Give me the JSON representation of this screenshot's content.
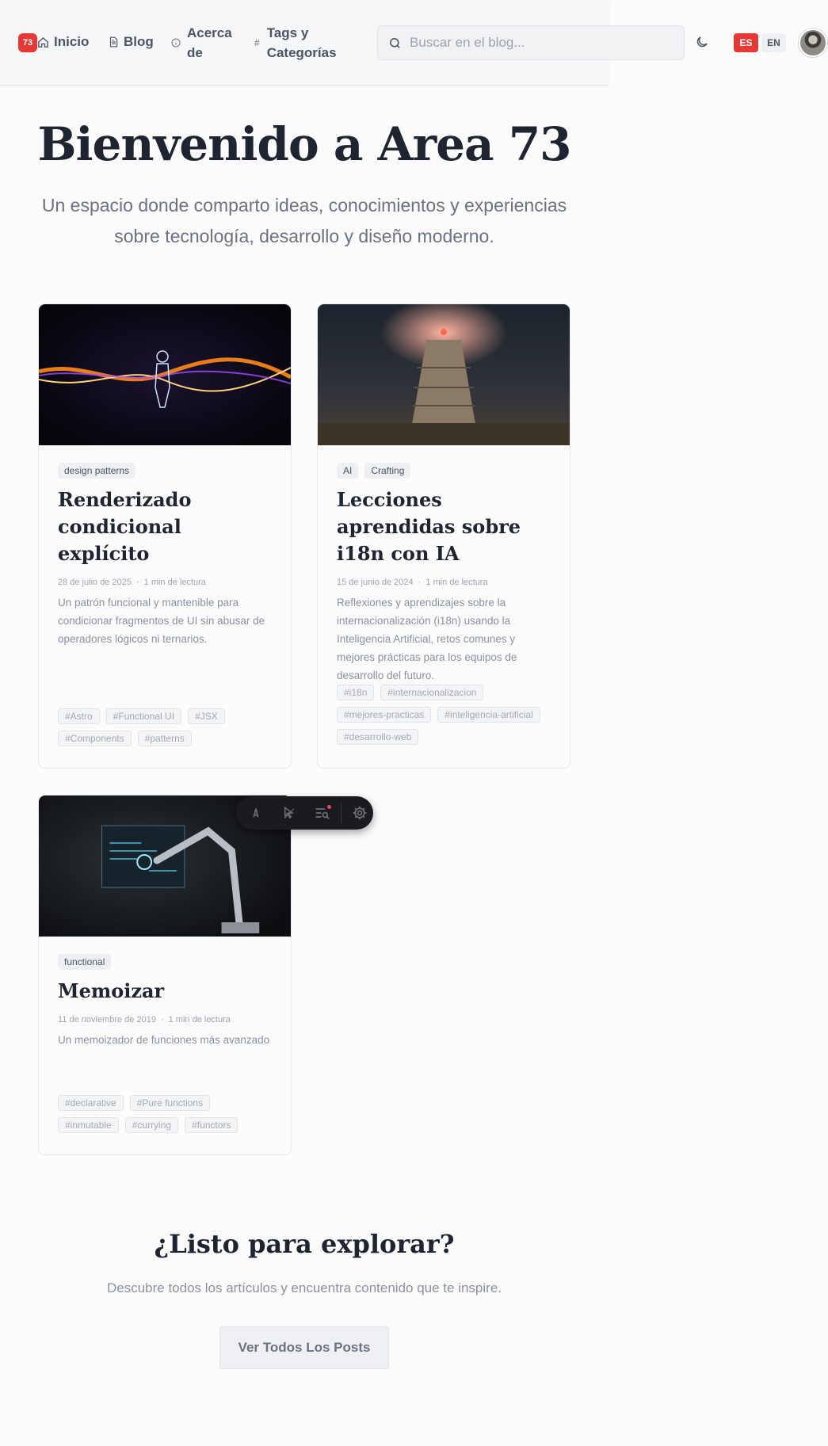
{
  "header": {
    "logo_text": "73",
    "nav": {
      "home": "Inicio",
      "blog": "Blog",
      "about_line1": "Acerca",
      "about_line2": "de",
      "tags_line1": "Tags y",
      "tags_line2": "Categorías"
    },
    "search_placeholder": "Buscar en el blog...",
    "lang_es": "ES",
    "lang_en": "EN",
    "accent": "#e53935"
  },
  "hero": {
    "title": "Bienvenido a Area 73",
    "subtitle": "Un espacio donde comparto ideas, conocimientos y experiencias sobre tecnología, desarrollo y diseño moderno."
  },
  "posts": [
    {
      "categories": [
        "design patterns"
      ],
      "title": "Renderizado condicional explícito",
      "date": "28 de julio de 2025",
      "read_time": "1 min de lectura",
      "description": "Un patrón funcional y mantenible para condicionar fragmentos de UI sin abusar de operadores lógicos ni ternarios.",
      "tags": [
        "#Astro",
        "#Functional UI",
        "#JSX",
        "#Components",
        "#patterns"
      ]
    },
    {
      "categories": [
        "AI",
        "Crafting"
      ],
      "title": "Lecciones aprendidas sobre i18n con IA",
      "date": "15 de junio de 2024",
      "read_time": "1 min de lectura",
      "description": "Reflexiones y aprendizajes sobre la internacionalización (i18n) usando la Inteligencia Artificial, retos comunes y mejores prácticas para los equipos de desarrollo del futuro.",
      "tags": [
        "#i18n",
        "#internacionalizacion",
        "#mejores-practicas",
        "#inteligencia-artificial",
        "#desarrollo-web"
      ]
    },
    {
      "categories": [
        "functional"
      ],
      "title": "Memoizar",
      "date": "11 de noviembre de 2019",
      "read_time": "1 min de lectura",
      "description": "Un memoizador de funciones más avanzado",
      "tags": [
        "#declarative",
        "#Pure functions",
        "#inmutable",
        "#currying",
        "#functors"
      ]
    }
  ],
  "cta": {
    "title": "¿Listo para explorar?",
    "subtitle": "Descubre todos los artículos y encuentra contenido que te inspire.",
    "button": "Ver Todos Los Posts"
  },
  "devbar": {
    "icons": [
      "astro-logo-icon",
      "inspect-cursor-icon",
      "audit-list-icon",
      "settings-gear-icon"
    ]
  }
}
